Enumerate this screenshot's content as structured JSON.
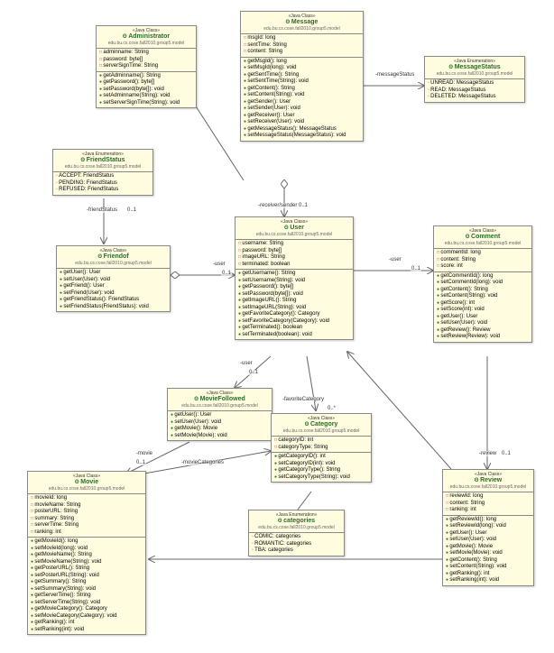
{
  "classes": {
    "administrator": {
      "stereotype": "«Java Class»",
      "name": "Administrator",
      "pkg": "edu.bu.cs.cose.fall2010.group5.model",
      "attrs": [
        "adminname: String",
        "password: byte[]",
        "serverSignTime: String"
      ],
      "ops": [
        "getAdminname(): String",
        "getPassword(): byte[]",
        "setPassword(byte[]): void",
        "setAdminname(String): void",
        "setServerSignTime(String): void"
      ]
    },
    "message": {
      "stereotype": "«Java Class»",
      "name": "Message",
      "pkg": "edu.bu.cs.cose.fall2010.group5.model",
      "attrs": [
        "msgId: long",
        "sentTime: String",
        "content: String"
      ],
      "ops": [
        "getMsgId(): long",
        "setMsgId(long): void",
        "getSentTime(): String",
        "setSentTime(String): void",
        "getContent(): String",
        "setContent(String): void",
        "getSender(): User",
        "setSender(User): void",
        "getReceiver(): User",
        "setReceiver(User): void",
        "getMessageStatus(): MessageStatus",
        "setMessageStatus(MessageStatus): void"
      ]
    },
    "messageStatus": {
      "stereotype": "«Java Enumeration»",
      "name": "MessageStatus",
      "pkg": "edu.bu.cs.cose.fall2010.group5.model",
      "enums": [
        "UNREAD: MessageStatus",
        "READ: MessageStatus",
        "DELETED: MessageStatus"
      ]
    },
    "friendStatus": {
      "stereotype": "«Java Enumeration»",
      "name": "FriendStatus",
      "pkg": "edu.bu.cs.cose.fall2010.group5.model",
      "enums": [
        "ACCEPT: FriendStatus",
        "PENDING: FriendStatus",
        "REFUSED: FriendStatus"
      ]
    },
    "friendof": {
      "stereotype": "«Java Class»",
      "name": "Friendof",
      "pkg": "edu.bu.cs.cose.fall2010.group5.model",
      "ops": [
        "getUser(): User",
        "setUser(User): void",
        "getFriend(): User",
        "setFriend(User): void",
        "getFriendStatus(): FriendStatus",
        "setFriendStatus(FriendStatus): void"
      ]
    },
    "user": {
      "stereotype": "«Java Class»",
      "name": "User",
      "pkg": "edu.bu.cs.cose.fall2010.group5.model",
      "attrs": [
        "username: String",
        "password: byte[]",
        "imageURL: String",
        "terminated: boolean"
      ],
      "ops": [
        "getUsername(): String",
        "setUsername(String): void",
        "getPassword(): byte[]",
        "setPassword(byte[]): void",
        "getImageURL(): String",
        "setImageURL(String): void",
        "getFavoriteCategory(): Category",
        "setFavoriteCategory(Category): void",
        "getTerminated(): boolean",
        "setTerminated(boolean): void"
      ]
    },
    "comment": {
      "stereotype": "«Java Class»",
      "name": "Comment",
      "pkg": "edu.bu.cs.cose.fall2010.group5.model",
      "attrs": [
        "commentId: long",
        "content: String",
        "score: int"
      ],
      "ops": [
        "getCommentId(): long",
        "setCommentId(long): void",
        "getContent(): String",
        "setContent(String): void",
        "getScore(): int",
        "setScore(int): void",
        "getUser(): User",
        "setUser(User): void",
        "getReview(): Review",
        "setReview(Review): void"
      ]
    },
    "movieFollowed": {
      "stereotype": "«Java Class»",
      "name": "MovieFollowed",
      "pkg": "edu.bu.cs.cose.fall2010.group5.model",
      "ops": [
        "getUser(): User",
        "setUser(User): void",
        "getMovie(): Movie",
        "setMovie(Movie): void"
      ]
    },
    "category": {
      "stereotype": "«Java Class»",
      "name": "Category",
      "pkg": "edu.bu.cs.cose.fall2010.group5.model",
      "attrs": [
        "categoryID: int",
        "categoryType: String"
      ],
      "ops": [
        "getCategoryID(): int",
        "setCategoryID(int): void",
        "getCategoryType(): String",
        "setCategoryType(String): void"
      ]
    },
    "categories": {
      "stereotype": "«Java Enumeration»",
      "name": "categories",
      "pkg": "edu.bu.cs.cose.fall2010.group5.model",
      "enums": [
        "COMIC: categories",
        "ROMANTIC: categories",
        "TBA: categories"
      ]
    },
    "movie": {
      "stereotype": "«Java Class»",
      "name": "Movie",
      "pkg": "edu.bu.cs.cose.fall2010.group5.model",
      "attrs": [
        "movieId: long",
        "movieName: String",
        "posterURL: String",
        "summary: String",
        "serverTime: String",
        "ranking: int"
      ],
      "ops": [
        "getMovieId(): long",
        "setMovieId(long): void",
        "getMovieName(): String",
        "setMovieName(String): void",
        "getPosterURL(): String",
        "setPosterURL(String): void",
        "getSummary(): String",
        "setSummary(String): void",
        "getServerTime(): String",
        "setServerTime(String): void",
        "getMovieCategory(): Category",
        "setMovieCategory(Category): void",
        "getRanking(): int",
        "setRanking(int): void"
      ]
    },
    "review": {
      "stereotype": "«Java Class»",
      "name": "Review",
      "pkg": "edu.bu.cs.cose.fall2010.group5.model",
      "attrs": [
        "reviewId: long",
        "content: String",
        "ranking: int"
      ],
      "ops": [
        "getReviewId(): long",
        "setReviewId(long): void",
        "getUser(): User",
        "setUser(User): void",
        "getMovie(): Movie",
        "setMovie(Movie): void",
        "getContent(): String",
        "setContent(String): void",
        "getRanking(): int",
        "setRanking(int): void"
      ]
    }
  },
  "labels": {
    "messageStatus": "-messageStatus",
    "receiverSender": "-receiver/sender",
    "friendStatusRole": "-friendStatus",
    "user": "-user",
    "favoriteCategory": "-favoriteCategory",
    "movieCategories": "-movieCategories",
    "movie": "-movie",
    "review": "-review",
    "m01": "0..1",
    "m0star": "0..*"
  }
}
